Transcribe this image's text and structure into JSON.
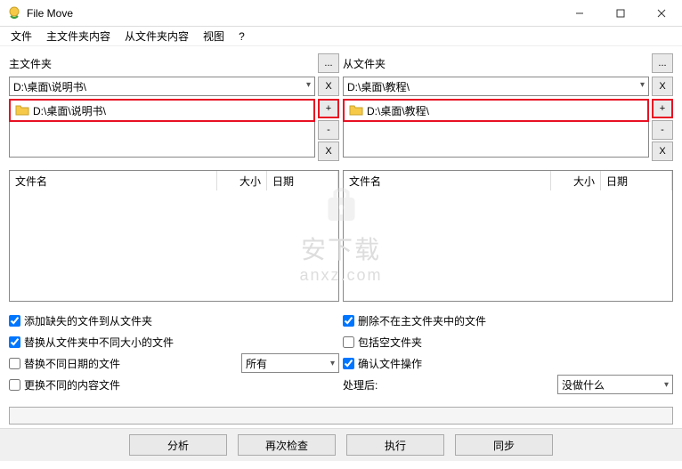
{
  "window": {
    "title": "File Move"
  },
  "menu": {
    "file": "文件",
    "main_content": "主文件夹内容",
    "slave_content": "从文件夹内容",
    "view": "视图",
    "help": "?"
  },
  "main": {
    "label": "主文件夹",
    "browse": "...",
    "path": "D:\\桌面\\说明书\\",
    "clear": "X",
    "folder_item": "D:\\桌面\\说明书\\",
    "add": "+",
    "remove": "-",
    "remove_all": "X",
    "col_name": "文件名",
    "col_size": "大小",
    "col_date": "日期"
  },
  "slave": {
    "label": "从文件夹",
    "browse": "...",
    "path": "D:\\桌面\\教程\\",
    "clear": "X",
    "folder_item": "D:\\桌面\\教程\\",
    "add": "+",
    "remove": "-",
    "remove_all": "X",
    "col_name": "文件名",
    "col_size": "大小",
    "col_date": "日期"
  },
  "options": {
    "add_missing": "添加缺失的文件到从文件夹",
    "replace_size": "替换从文件夹中不同大小的文件",
    "replace_date": "替换不同日期的文件",
    "replace_content": "更换不同的内容文件",
    "all_label": "所有",
    "delete_not_in_main": "删除不在主文件夹中的文件",
    "include_empty": "包括空文件夹",
    "confirm_ops": "确认文件操作",
    "after_label": "处理后:",
    "after_value": "没做什么"
  },
  "actions": {
    "analyze": "分析",
    "recheck": "再次检查",
    "execute": "执行",
    "sync": "同步"
  },
  "checked": {
    "add_missing": true,
    "replace_size": true,
    "replace_date": false,
    "replace_content": false,
    "delete_not_in_main": true,
    "include_empty": false,
    "confirm_ops": true
  },
  "watermark": {
    "line1": "安下载",
    "line2": "anxz.com"
  }
}
